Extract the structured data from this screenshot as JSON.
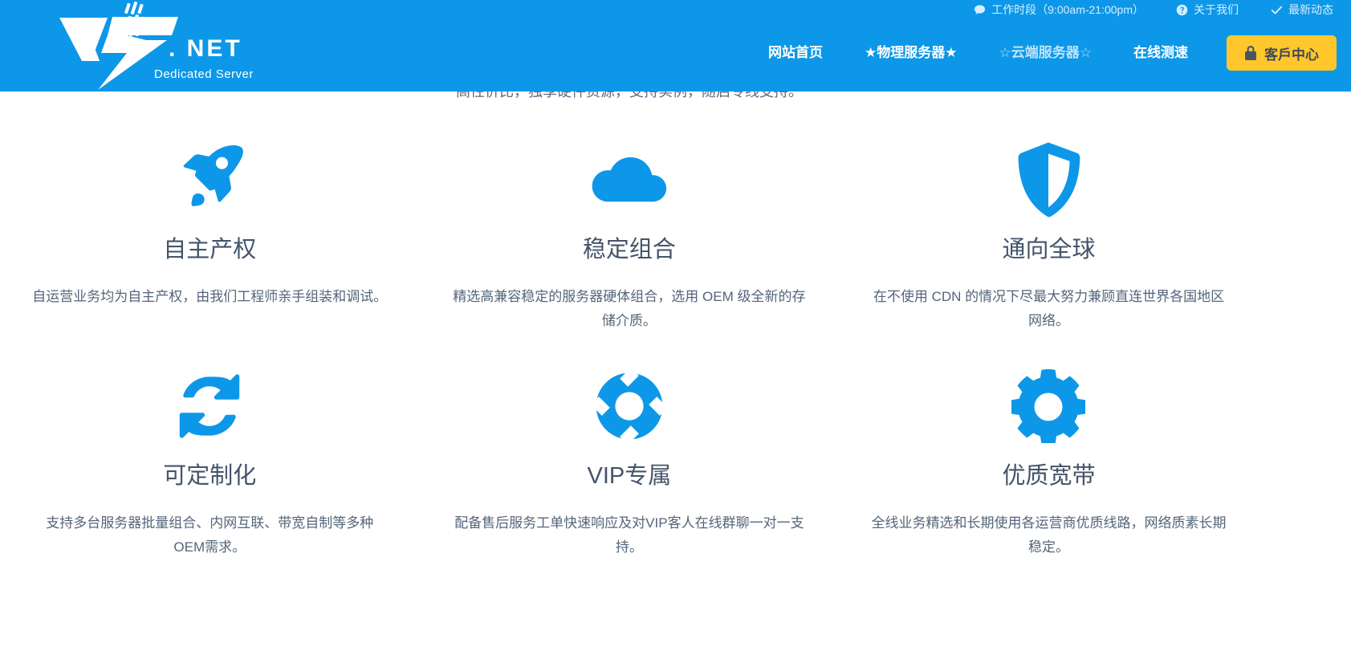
{
  "brand": {
    "logo_text": ". NET",
    "logo_tagline": "Dedicated Server",
    "accent_blue": "#0d97e8",
    "icon_blue": "#0d97e8",
    "button_yellow": "#ffc72c",
    "title_color": "#44546a"
  },
  "topbar": {
    "items": [
      {
        "icon": "chat-bubble-icon",
        "label": "工作时段（9:00am-21:00pm）"
      },
      {
        "icon": "question-circle-icon",
        "label": "关于我们"
      },
      {
        "icon": "check-icon",
        "label": "最新动态"
      }
    ]
  },
  "nav": {
    "links": [
      {
        "label": "网站首页",
        "dim": false
      },
      {
        "label": "★物理服务器★",
        "dim": false
      },
      {
        "label": "☆云端服务器☆",
        "dim": true
      },
      {
        "label": "在线测速",
        "dim": false
      }
    ],
    "client_button": {
      "label": "客戶中心",
      "icon": "lock-icon"
    }
  },
  "content": {
    "clipped_line": "高性价比，独享硬件资源，支持实例，随启专线支持。",
    "features": [
      {
        "icon": "rocket-icon",
        "title": "自主产权",
        "desc": "自运营业务均为自主产权，由我们工程师亲手组装和调试。"
      },
      {
        "icon": "cloud-icon",
        "title": "稳定组合",
        "desc": "精选高兼容稳定的服务器硬体组合，选用 OEM 级全新的存储介质。"
      },
      {
        "icon": "shield-icon",
        "title": "通向全球",
        "desc": "在不使用 CDN 的情况下尽最大努力兼顾直连世界各国地区网络。"
      },
      {
        "icon": "sync-arrows-icon",
        "title": "可定制化",
        "desc": "支持多台服务器批量组合、内网互联、带宽自制等多种OEM需求。"
      },
      {
        "icon": "lifebuoy-icon",
        "title": "VIP专属",
        "desc": "配备售后服务工单快速响应及对VIP客人在线群聊一对一支持。"
      },
      {
        "icon": "gear-icon",
        "title": "优质宽带",
        "desc": "全线业务精选和长期使用各运营商优质线路，网络质素长期稳定。"
      }
    ]
  }
}
